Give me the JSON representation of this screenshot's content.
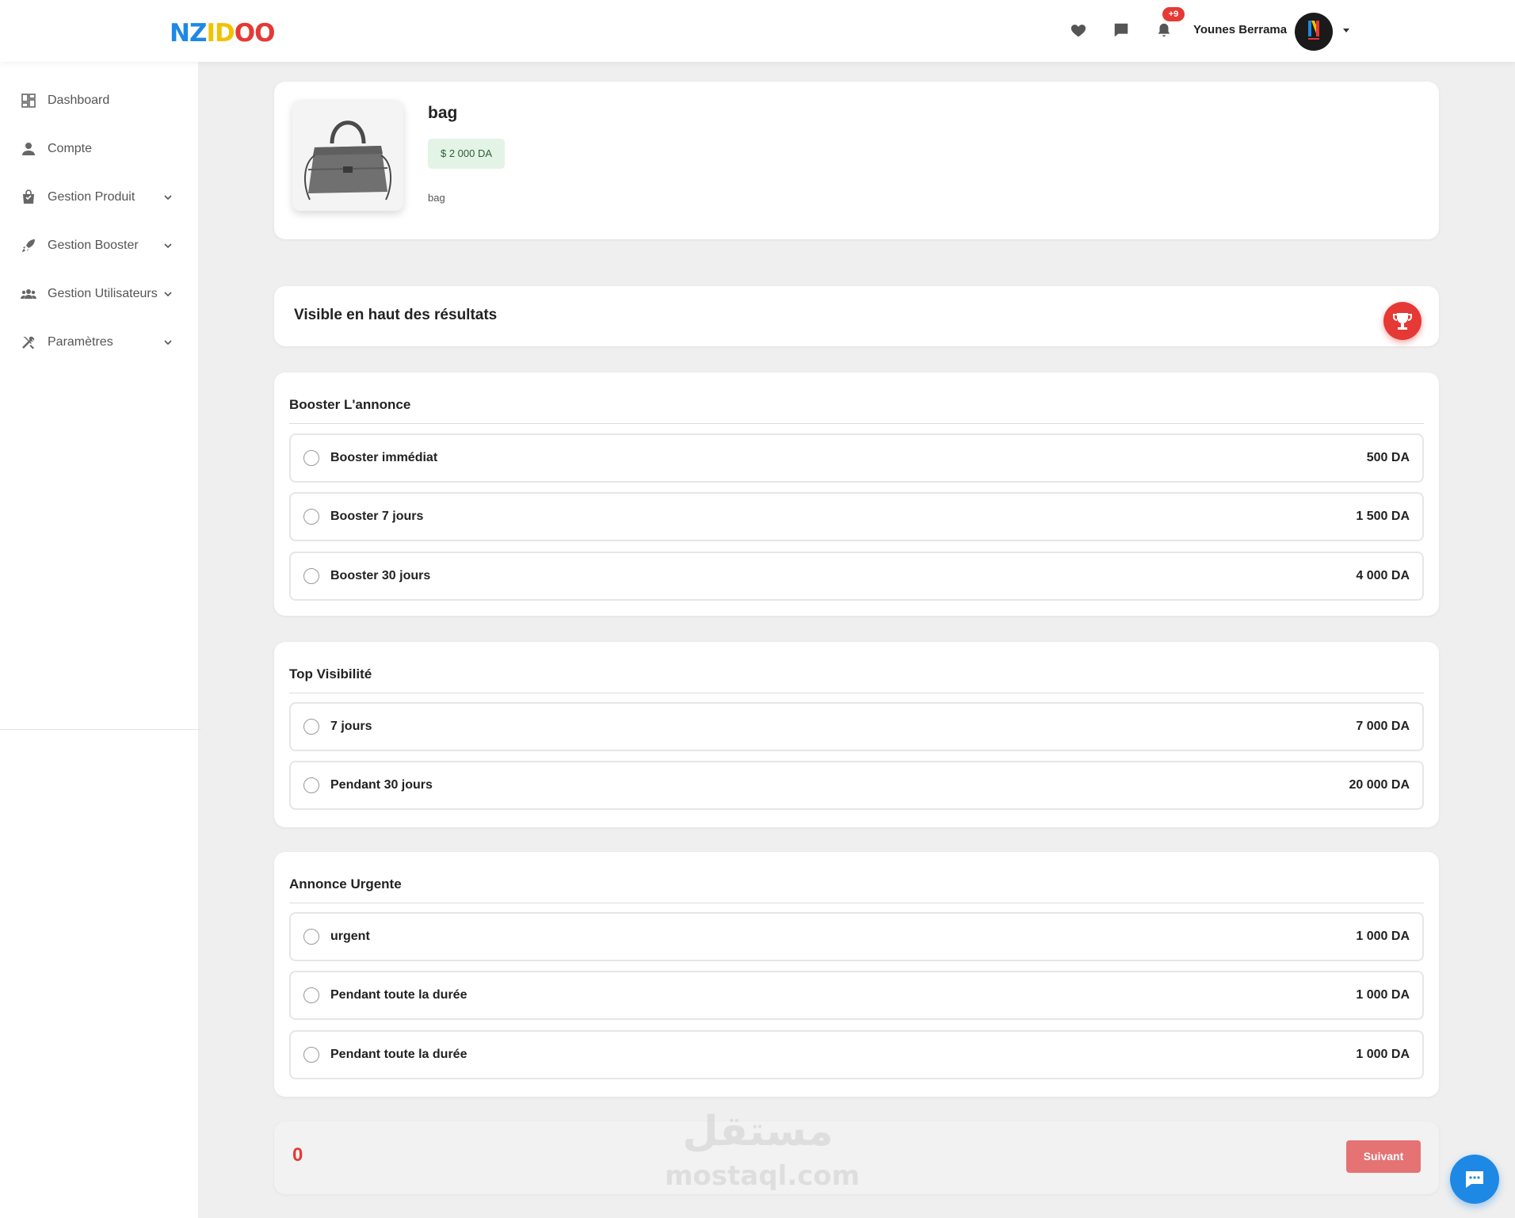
{
  "app": {
    "logo_letters": [
      {
        "char": "N",
        "color": "#1e88e5"
      },
      {
        "char": "Z",
        "color": "#1e88e5"
      },
      {
        "char": "I",
        "color": "#f2c200"
      },
      {
        "char": "D",
        "color": "#f2c200"
      },
      {
        "char": "O",
        "color": "#e53935"
      },
      {
        "char": "O",
        "color": "#e53935"
      }
    ]
  },
  "header": {
    "icons": [
      "heart-icon",
      "chat-icon",
      "bell-icon"
    ],
    "notification_count": "+9",
    "user_name": "Younes Berrama",
    "avatar_letter": "N"
  },
  "sidebar": {
    "items": [
      {
        "label": "Dashboard",
        "icon": "dashboard-icon",
        "has_children": false
      },
      {
        "label": "Compte",
        "icon": "user-icon",
        "has_children": false
      },
      {
        "label": "Gestion Produit",
        "icon": "shopping-bag-icon",
        "has_children": true
      },
      {
        "label": "Gestion Booster",
        "icon": "rocket-icon",
        "has_children": true
      },
      {
        "label": "Gestion Utilisateurs",
        "icon": "users-icon",
        "has_children": true
      },
      {
        "label": "Paramètres",
        "icon": "tools-icon",
        "has_children": true
      }
    ]
  },
  "product": {
    "title": "bag",
    "price": "$ 2 000 DA",
    "description": "bag"
  },
  "visibility": {
    "title": "Visible en haut des résultats",
    "icon": "trophy-icon"
  },
  "sections": [
    {
      "title": "Booster L'annonce",
      "options": [
        {
          "label": "Booster immédiat",
          "price": "500 DA"
        },
        {
          "label": "Booster 7 jours",
          "price": "1 500 DA"
        },
        {
          "label": "Booster 30 jours",
          "price": "4 000 DA"
        }
      ]
    },
    {
      "title": "Top Visibilité",
      "options": [
        {
          "label": "7 jours",
          "price": "7 000 DA"
        },
        {
          "label": "Pendant 30 jours",
          "price": "20 000 DA"
        }
      ]
    },
    {
      "title": "Annonce Urgente",
      "options": [
        {
          "label": "urgent",
          "price": "1 000 DA"
        },
        {
          "label": "Pendant toute la durée",
          "price": "1 000 DA"
        },
        {
          "label": "Pendant toute la durée",
          "price": "1 000 DA"
        }
      ]
    }
  ],
  "footer": {
    "total": "0",
    "next_label": "Suivant"
  },
  "watermark": {
    "arabic": "مستقل",
    "latin": "mostaql.com"
  },
  "colors": {
    "accent_red": "#e53935",
    "button_disabled": "#e57373",
    "chat_blue": "#1e88e5",
    "price_chip_bg": "#e3f4e6"
  }
}
